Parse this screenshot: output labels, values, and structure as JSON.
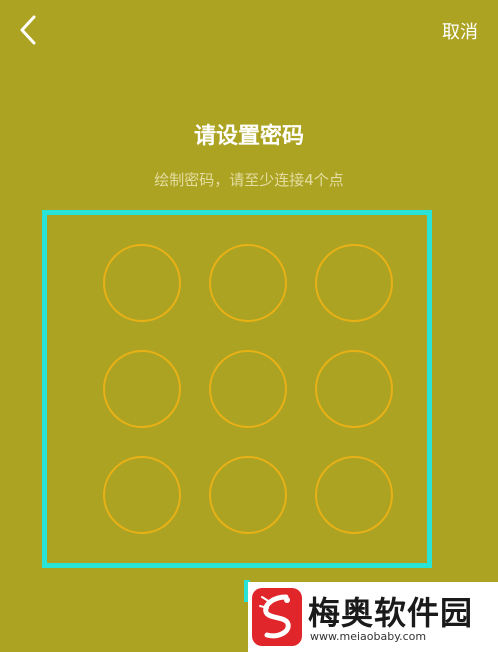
{
  "header": {
    "back_icon": "chevron-left-icon",
    "cancel_label": "取消"
  },
  "main": {
    "title": "请设置密码",
    "subtitle": "绘制密码，请至少连接4个点",
    "grid_rows": 3,
    "grid_cols": 3
  },
  "watermark": {
    "logo_icon": "dragon-logo-icon",
    "name": "梅奥软件园",
    "url": "www.meiaobaby.com"
  },
  "colors": {
    "background": "#ada323",
    "highlight": "#29e3d6",
    "dot_stroke": "#e8b116",
    "text": "#ffffff",
    "subtitle_text": "#e4dda0",
    "watermark_red": "#e0262a"
  }
}
